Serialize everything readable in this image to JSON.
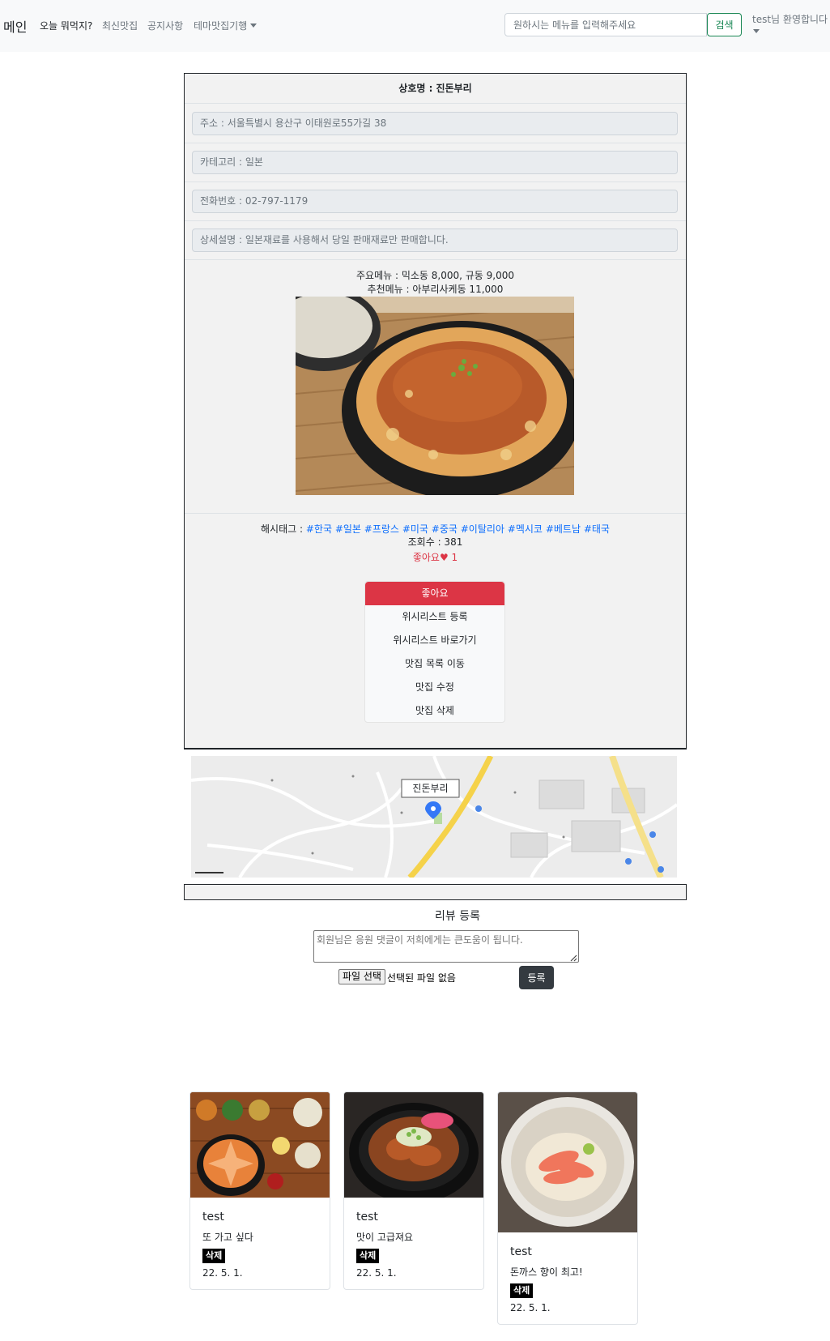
{
  "nav": {
    "brand": "메인",
    "links": [
      "오늘 뭐먹지?",
      "최신맛집",
      "공지사항",
      "테마맛집기행"
    ],
    "search_placeholder": "원하시는 메뉴를 입력해주세요",
    "search_button": "검색",
    "welcome": "test님 환영합니다"
  },
  "restaurant": {
    "name": "상호명 : 진돈부리",
    "address": "주소  : 서울특별시 용산구 이태원로55가길 38",
    "category": "카테고리  : 일본",
    "phone": "전화번호  : 02-797-1179",
    "description": "상세설명  : 일본재료를 사용해서 당일 판매재료만 판매합니다.",
    "main_menu": "주요메뉴 : 믹소동 8,000, 규동 9,000",
    "recommended_menu": "추천메뉴 : 아부리사케동 11,000",
    "hashtag_label": "해시태그 : ",
    "hashtags": [
      "#한국",
      "#일본",
      "#프랑스",
      "#미국",
      "#중국",
      "#이탈리아",
      "#멕시코",
      "#베트남",
      "#태국"
    ],
    "views": "조회수 : 381",
    "likes": "좋아요♥ 1",
    "map_label": "진돈부리"
  },
  "actions": [
    "좋아요",
    "위시리스트 등록",
    "위시리스트 바로가기",
    "맛집 목록 이동",
    "맛집 수정",
    "맛집 삭제"
  ],
  "review_form": {
    "title": "리뷰 등록",
    "placeholder": "회원님은 응원 댓글이 저희에게는 큰도움이 됩니다.",
    "file_button": "파일 선택",
    "file_status": "선택된 파일 없음",
    "submit": "등록"
  },
  "reviews": [
    {
      "author": "test",
      "text": "또 가고 싶다",
      "delete": "삭제",
      "date": "22. 5. 1."
    },
    {
      "author": "test",
      "text": "맛이 고급져요",
      "delete": "삭제",
      "date": "22. 5. 1."
    },
    {
      "author": "test",
      "text": "돈까스 향이 최고!",
      "delete": "삭제",
      "date": "22. 5. 1."
    }
  ],
  "colors": {
    "danger": "#dc3545",
    "success": "#198754",
    "link": "#0d6efd",
    "dark": "#343a40"
  }
}
